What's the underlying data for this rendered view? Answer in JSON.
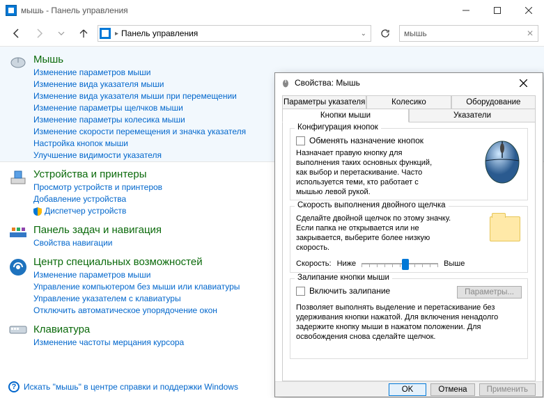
{
  "window": {
    "title": "мышь - Панель управления"
  },
  "nav": {
    "breadcrumb": "Панель управления",
    "search_value": "мышь"
  },
  "sections": [
    {
      "title": "Мышь",
      "links": [
        "Изменение параметров мыши",
        "Изменение вида указателя мыши",
        "Изменение вида указателя мыши при перемещении",
        "Изменение параметры щелчков мыши",
        "Изменение параметры колесика мыши",
        "Изменение скорости перемещения и значка указателя",
        "Настройка кнопок мыши",
        "Улучшение видимости указателя"
      ]
    },
    {
      "title": "Устройства и принтеры",
      "links": [
        "Просмотр устройств и принтеров",
        "Добавление устройства",
        "Диспетчер устройств"
      ],
      "shield_index": 2
    },
    {
      "title": "Панель задач и навигация",
      "links": [
        "Свойства навигации"
      ]
    },
    {
      "title": "Центр специальных возможностей",
      "links": [
        "Изменение параметров мыши",
        "Управление компьютером без мыши или клавиатуры",
        "Управление указателем с клавиатуры",
        "Отключить автоматическое упорядочение окон"
      ]
    },
    {
      "title": "Клавиатура",
      "links": [
        "Изменение частоты мерцания курсора"
      ]
    }
  ],
  "help_link": "Искать \"мышь\" в центре справки и поддержки Windows",
  "dialog": {
    "title": "Свойства: Мышь",
    "tabs_top": [
      "Параметры указателя",
      "Колесико",
      "Оборудование"
    ],
    "tabs_bottom": [
      "Кнопки мыши",
      "Указатели"
    ],
    "group_buttons": {
      "title": "Конфигурация кнопок",
      "checkbox": "Обменять назначение кнопок",
      "desc": "Назначает правую кнопку для выполнения таких основных функций, как выбор и перетаскивание. Часто используется теми, кто работает с мышью левой рукой."
    },
    "group_speed": {
      "title": "Скорость выполнения двойного щелчка",
      "desc": "Сделайте двойной щелчок по этому значку. Если папка не открывается или не закрывается, выберите более низкую скорость.",
      "speed_label": "Скорость:",
      "low": "Ниже",
      "high": "Выше"
    },
    "group_lock": {
      "title": "Залипание кнопки мыши",
      "checkbox": "Включить залипание",
      "params_btn": "Параметры...",
      "desc": "Позволяет выполнять выделение и перетаскивание без удерживания кнопки нажатой. Для включения ненадолго задержите кнопку мыши в нажатом положении. Для освобождения снова сделайте щелчок."
    },
    "buttons": {
      "ok": "OK",
      "cancel": "Отмена",
      "apply": "Применить"
    }
  }
}
